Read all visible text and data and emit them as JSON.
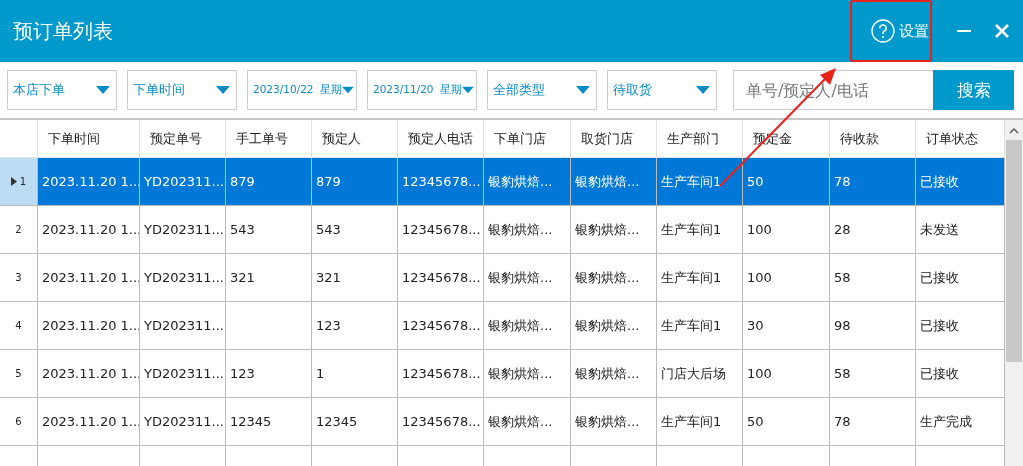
{
  "window": {
    "title": "预订单列表",
    "help_label": "设置"
  },
  "filters": [
    {
      "value": "本店下单",
      "kind": "select"
    },
    {
      "value": "下单时间",
      "kind": "select"
    },
    {
      "value": "2023/10/22  星期",
      "kind": "date"
    },
    {
      "value": "2023/11/20  星期",
      "kind": "date"
    },
    {
      "value": "全部类型",
      "kind": "select"
    },
    {
      "value": "待取货",
      "kind": "select"
    }
  ],
  "search": {
    "placeholder": "单号/预定人/电话",
    "button": "搜索"
  },
  "table": {
    "columns": [
      "下单时间",
      "预定单号",
      "手工单号",
      "预定人",
      "预定人电话",
      "下单门店",
      "取货门店",
      "生产部门",
      "预定金",
      "待收款",
      "订单状态"
    ],
    "rows": [
      {
        "number": "1",
        "selected": true,
        "cells": [
          "2023.11.20 1...",
          "YD202311...",
          "879",
          "879",
          "12345678...",
          "银豹烘焙...",
          "银豹烘焙...",
          "生产车间1",
          "50",
          "78",
          "已接收"
        ]
      },
      {
        "number": "2",
        "selected": false,
        "cells": [
          "2023.11.20 1...",
          "YD202311...",
          "543",
          "543",
          "12345678...",
          "银豹烘焙...",
          "银豹烘焙...",
          "生产车间1",
          "100",
          "28",
          "未发送"
        ]
      },
      {
        "number": "3",
        "selected": false,
        "cells": [
          "2023.11.20 1...",
          "YD202311...",
          "321",
          "321",
          "12345678...",
          "银豹烘焙...",
          "银豹烘焙...",
          "生产车间1",
          "100",
          "58",
          "已接收"
        ]
      },
      {
        "number": "4",
        "selected": false,
        "cells": [
          "2023.11.20 1...",
          "YD202311...",
          null,
          "123",
          "12345678...",
          "银豹烘焙...",
          "银豹烘焙...",
          "生产车间1",
          "30",
          "98",
          "已接收"
        ]
      },
      {
        "number": "5",
        "selected": false,
        "cells": [
          "2023.11.20 1...",
          "YD202311...",
          "123",
          "1",
          "12345678...",
          "银豹烘焙...",
          "银豹烘焙...",
          "门店大后场",
          "100",
          "58",
          "已接收"
        ]
      },
      {
        "number": "6",
        "selected": false,
        "cells": [
          "2023.11.20 1...",
          "YD202311...",
          "12345",
          "12345",
          "12345678...",
          "银豹烘焙...",
          "银豹烘焙...",
          "生产车间1",
          "50",
          "78",
          "生产完成"
        ]
      }
    ]
  }
}
